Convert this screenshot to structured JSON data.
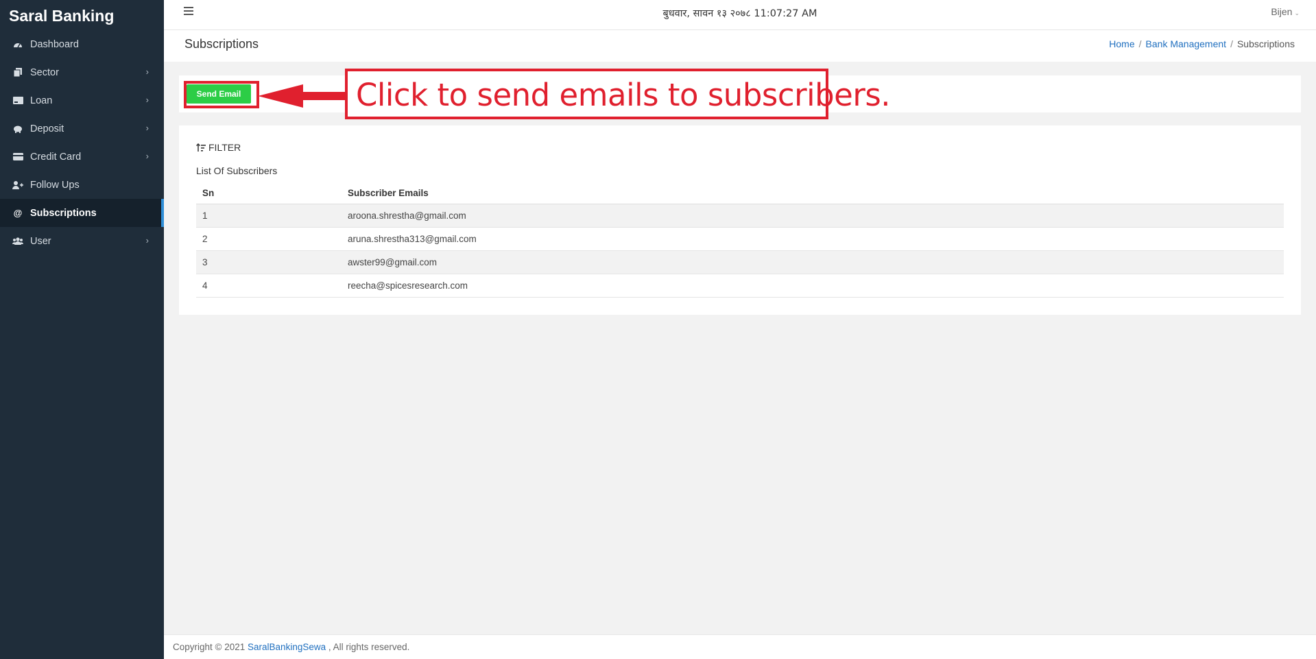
{
  "sidebar": {
    "brand": "Saral Banking",
    "items": [
      {
        "label": "Dashboard",
        "icon": "dashboard-icon",
        "has_children": false
      },
      {
        "label": "Sector",
        "icon": "copy-icon",
        "has_children": true
      },
      {
        "label": "Loan",
        "icon": "money-icon",
        "has_children": true
      },
      {
        "label": "Deposit",
        "icon": "piggy-bank-icon",
        "has_children": true
      },
      {
        "label": "Credit Card",
        "icon": "credit-card-icon",
        "has_children": true
      },
      {
        "label": "Follow Ups",
        "icon": "user-plus-icon",
        "has_children": false
      },
      {
        "label": "Subscriptions",
        "icon": "at-icon",
        "has_children": false,
        "active": true
      },
      {
        "label": "User",
        "icon": "users-icon",
        "has_children": true
      }
    ],
    "chevron": "›"
  },
  "topbar": {
    "datetime": "बुधवार, सावन १३ २०७८ 11:07:27 AM",
    "user": "Bijen"
  },
  "page": {
    "title": "Subscriptions",
    "breadcrumb": {
      "home": "Home",
      "section": "Bank Management",
      "current": "Subscriptions",
      "separator": "/"
    }
  },
  "actions": {
    "send_email_label": "Send Email"
  },
  "annotation": {
    "text": "Click to send emails to subscribers.",
    "color": "#e0202e"
  },
  "subscribers": {
    "filter_label": "FILTER",
    "title": "List Of Subscribers",
    "columns": [
      "Sn",
      "Subscriber Emails"
    ],
    "rows": [
      {
        "sn": "1",
        "email": "aroona.shrestha@gmail.com"
      },
      {
        "sn": "2",
        "email": "aruna.shrestha313@gmail.com"
      },
      {
        "sn": "3",
        "email": "awster99@gmail.com"
      },
      {
        "sn": "4",
        "email": "reecha@spicesresearch.com"
      }
    ]
  },
  "footer": {
    "prefix": "Copyright © 2021",
    "link": "SaralBankingSewa",
    "suffix": ", All rights reserved."
  },
  "colors": {
    "sidebar_bg": "#1f2d3a",
    "accent": "#2f8fd8",
    "button_green": "#2ccd46",
    "link_blue": "#1f6fbf"
  }
}
